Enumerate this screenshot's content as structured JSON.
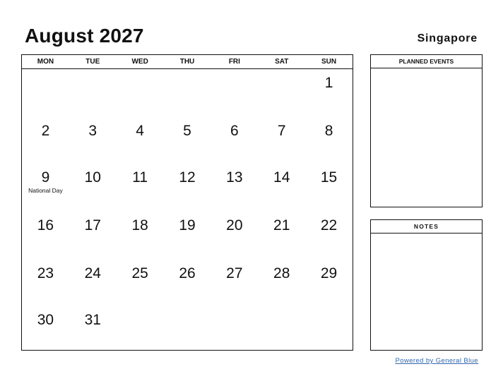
{
  "header": {
    "title": "August 2027",
    "country": "Singapore"
  },
  "calendar": {
    "weekdays": [
      "MON",
      "TUE",
      "WED",
      "THU",
      "FRI",
      "SAT",
      "SUN"
    ],
    "weeks": [
      [
        {
          "day": ""
        },
        {
          "day": ""
        },
        {
          "day": ""
        },
        {
          "day": ""
        },
        {
          "day": ""
        },
        {
          "day": ""
        },
        {
          "day": "1"
        }
      ],
      [
        {
          "day": "2"
        },
        {
          "day": "3"
        },
        {
          "day": "4"
        },
        {
          "day": "5"
        },
        {
          "day": "6"
        },
        {
          "day": "7"
        },
        {
          "day": "8"
        }
      ],
      [
        {
          "day": "9",
          "event": "National Day"
        },
        {
          "day": "10"
        },
        {
          "day": "11"
        },
        {
          "day": "12"
        },
        {
          "day": "13"
        },
        {
          "day": "14"
        },
        {
          "day": "15"
        }
      ],
      [
        {
          "day": "16"
        },
        {
          "day": "17"
        },
        {
          "day": "18"
        },
        {
          "day": "19"
        },
        {
          "day": "20"
        },
        {
          "day": "21"
        },
        {
          "day": "22"
        }
      ],
      [
        {
          "day": "23"
        },
        {
          "day": "24"
        },
        {
          "day": "25"
        },
        {
          "day": "26"
        },
        {
          "day": "27"
        },
        {
          "day": "28"
        },
        {
          "day": "29"
        }
      ],
      [
        {
          "day": "30"
        },
        {
          "day": "31"
        },
        {
          "day": ""
        },
        {
          "day": ""
        },
        {
          "day": ""
        },
        {
          "day": ""
        },
        {
          "day": ""
        }
      ]
    ]
  },
  "panels": {
    "events_title": "PLANNED EVENTS",
    "notes_title": "NOTES"
  },
  "footer": {
    "powered_by": "Powered by General Blue",
    "link_color": "#3366aa"
  }
}
